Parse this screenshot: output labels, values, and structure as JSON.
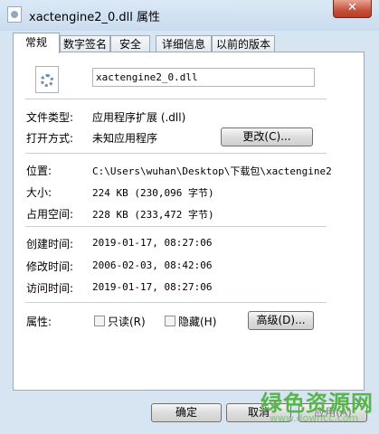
{
  "window": {
    "title": "xactengine2_0.dll 属性",
    "close_label": "✕"
  },
  "tabs": [
    {
      "label": "常规"
    },
    {
      "label": "数字签名"
    },
    {
      "label": "安全"
    },
    {
      "label": "详细信息"
    },
    {
      "label": "以前的版本"
    }
  ],
  "general": {
    "file_name": "xactengine2_0.dll",
    "type_label": "文件类型:",
    "type_value": "应用程序扩展 (.dll)",
    "open_label": "打开方式:",
    "open_value": "未知应用程序",
    "change_button": "更改(C)...",
    "location_label": "位置:",
    "location_value": "C:\\Users\\wuhan\\Desktop\\下载包\\xactengine2",
    "size_label": "大小:",
    "size_value": "224 KB (230,096 字节)",
    "disk_label": "占用空间:",
    "disk_value": "228 KB (233,472 字节)",
    "created_label": "创建时间:",
    "created_value": "2019-01-17, 08:27:06",
    "modified_label": "修改时间:",
    "modified_value": "2006-02-03, 08:42:06",
    "accessed_label": "访问时间:",
    "accessed_value": "2019-01-17, 08:27:06",
    "attributes_label": "属性:",
    "readonly_label": "只读(R)",
    "hidden_label": "隐藏(H)",
    "advanced_button": "高级(D)..."
  },
  "footer": {
    "ok_button": "确定",
    "cancel_button": "取消",
    "apply_button": "应用(A)"
  },
  "watermark": {
    "main": "绿色资源网",
    "sub": "www.downcc.com"
  }
}
